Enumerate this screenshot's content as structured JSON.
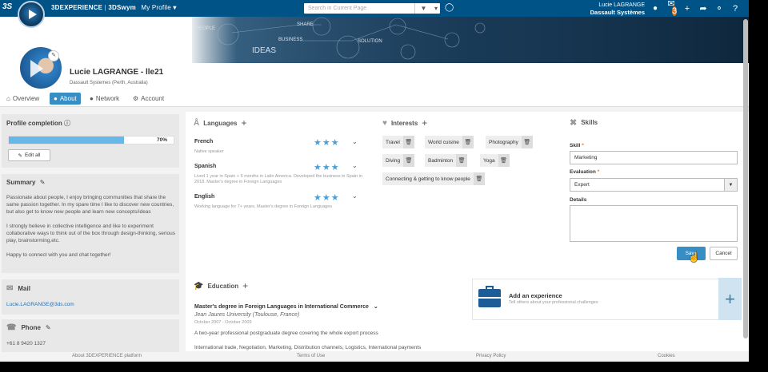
{
  "topbar": {
    "logo": "3S",
    "brand": "3DEXPERIENCE",
    "separator": "|",
    "app": "3DSwym",
    "context": "My Profile",
    "search_placeholder": "Search in Current Page",
    "user_name": "Lucie LAGRANGE",
    "company": "Dassault Systèmes",
    "notification_count": "3"
  },
  "banner": {
    "words": [
      "PEOPLE",
      "SHARE",
      "BUSINESS",
      "IDEAS",
      "SOLUTION"
    ]
  },
  "profile": {
    "name": "Lucie LAGRANGE - lle21",
    "org": "Dassault Systemes (Perth, Australia)"
  },
  "tabs": [
    {
      "label": "Overview",
      "icon": "home-icon"
    },
    {
      "label": "About",
      "icon": "user-icon"
    },
    {
      "label": "Network",
      "icon": "network-icon"
    },
    {
      "label": "Account",
      "icon": "gear-icon"
    }
  ],
  "completion": {
    "title": "Profile completion",
    "percent_label": "70%",
    "percent": 70,
    "edit_all": "Edit all"
  },
  "summary": {
    "title": "Summary",
    "p1": "Passionate about people, I enjoy bringing communities that share the same passion together. In my spare time I like to discover new countries, but also get to know new people and learn new concepts/ideas",
    "p2": "I strongly believe in collective intelligence and like to experiment collaborative ways to think out of the box through design-thinking, serious play, brainstorming,etc.",
    "p3": "Happy to connect with you and chat together!"
  },
  "mail": {
    "title": "Mail",
    "value": "Lucie.LAGRANGE@3ds.com"
  },
  "phone": {
    "title": "Phone",
    "value": "+61 8 9420 1327"
  },
  "languages": {
    "title": "Languages",
    "items": [
      {
        "name": "French",
        "desc": "Native speaker",
        "stars": 3
      },
      {
        "name": "Spanish",
        "desc": "Lived 1 year in Spain + 6 months in Latin America. Developed the business in Spain in 2018. Master's degree in Foreign Languages",
        "stars": 3
      },
      {
        "name": "English",
        "desc": "Working language for 7+ years, Master's degree in Foreign Languages",
        "stars": 3
      }
    ]
  },
  "interests": {
    "title": "Interests",
    "items": [
      "Travel",
      "World cuisine",
      "Photography",
      "Diving",
      "Badminton",
      "Yoga",
      "Connecting & getting to know people"
    ]
  },
  "skills": {
    "title": "Skills",
    "skill_label": "Skill",
    "skill_value": "Marketing",
    "evaluation_label": "Evaluation",
    "evaluation_value": "Expert",
    "details_label": "Details",
    "save": "Save",
    "cancel": "Cancel"
  },
  "education": {
    "title": "Education",
    "degree": "Master's degree in Foreign Languages in International Commerce",
    "school": "Jean Jaures University (Toulouse, France)",
    "dates": "October 2007 - October 2009",
    "desc": "A two-year professional postgraduate degree covering the whole export process",
    "topics": "International trade, Negotiation, Marketing, Distribution channels, Logistics, International payments"
  },
  "experience": {
    "title": "Add an experience",
    "subtitle": "Tell others about your professional challenges"
  },
  "footer": {
    "about": "About 3DEXPERIENCE platform",
    "terms": "Terms of Use",
    "privacy": "Privacy Policy",
    "cookies": "Cookies"
  },
  "colors": {
    "topbar": "#005386",
    "accent": "#368ec4",
    "stars": "#4a9fd8"
  }
}
